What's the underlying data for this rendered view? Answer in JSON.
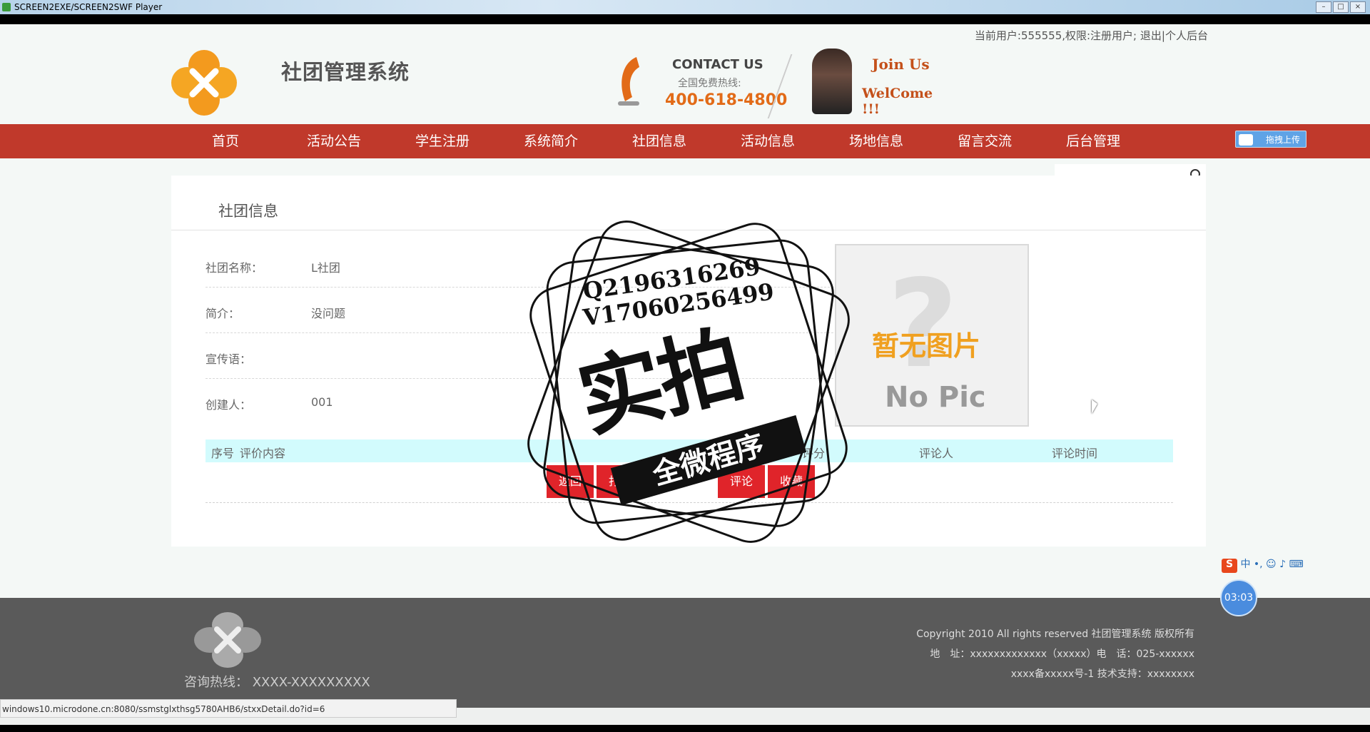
{
  "window": {
    "title": "SCREEN2EXE/SCREEN2SWF Player"
  },
  "header": {
    "user_info": "当前用户:555555,权限:注册用户;",
    "logout": "退出",
    "sep": "|",
    "admin_link": "个人后台",
    "site_title": "社团管理系统",
    "contact_title": "CONTACT US",
    "hotline_label": "全国免费热线:",
    "phone": "400-618-4800",
    "join_us": "Join Us",
    "welcome": "WelCome !!!"
  },
  "nav": {
    "items": [
      "首页",
      "活动公告",
      "学生注册",
      "系统简介",
      "社团信息",
      "活动信息",
      "场地信息",
      "留言交流",
      "后台管理"
    ],
    "upload_label": "拖拽上传"
  },
  "main": {
    "heading": "社团信息",
    "fields": [
      {
        "label": "社团名称：",
        "value": "L社团"
      },
      {
        "label": "简介：",
        "value": "没问题"
      },
      {
        "label": "宣传语：",
        "value": ""
      },
      {
        "label": "创建人：",
        "value": "001"
      }
    ],
    "image": {
      "cn": "暂无图片",
      "en": "No Pic"
    },
    "table_headers": [
      "序号",
      "评价内容",
      "评分",
      "评论人",
      "评论时间"
    ],
    "buttons": [
      "返回",
      "打印",
      "评论",
      "收藏"
    ]
  },
  "watermark": {
    "line1": "Q2196316269",
    "line2": "V17060256499",
    "big": "实拍",
    "ribbon": "全微程序"
  },
  "footer": {
    "hotline": "咨询热线：  XXXX-XXXXXXXXX",
    "copyright": "Copyright 2010 All rights reserved 社团管理系统 版权所有",
    "address": "地　址：xxxxxxxxxxxxx（xxxxx）电　话：025-xxxxxx",
    "icp": "xxxx备xxxxx号-1 技术支持：xxxxxxxx"
  },
  "overlay": {
    "ime": "中 •, ☺ ♪ ⌨",
    "timer": "03:03"
  },
  "statusbar": {
    "url": "windows10.microdone.cn:8080/ssmstglxthsg5780AHB6/stxxDetail.do?id=6"
  },
  "colors": {
    "nav_bg": "#c0392b",
    "button_red": "#e0242a",
    "table_header": "#d2fbfd",
    "footer_bg": "#5a5a5a"
  }
}
